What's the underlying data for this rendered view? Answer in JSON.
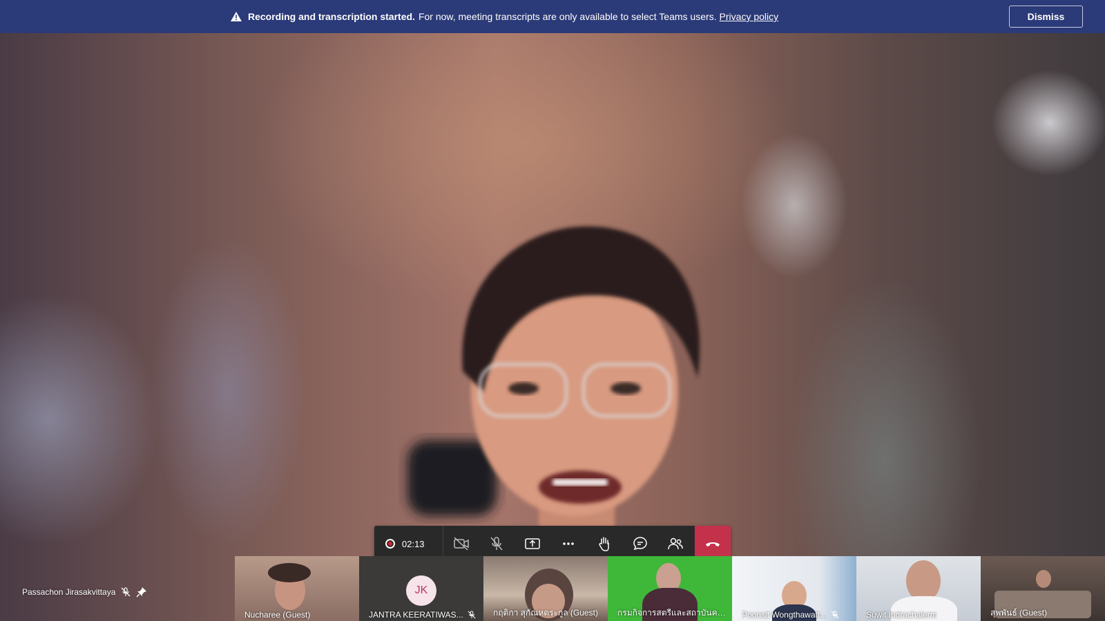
{
  "banner": {
    "bold_text": "Recording and transcription started.",
    "message": "For now, meeting transcripts are only available to select Teams users.",
    "link": "Privacy policy",
    "dismiss_label": "Dismiss",
    "background_color": "#2b3a78"
  },
  "stage": {
    "participant_name": "Passachon Jirasakvittaya",
    "icons": [
      "mic-off-icon",
      "pin-icon"
    ]
  },
  "controls": {
    "recording_time": "02:13",
    "buttons": [
      "camera-off-icon",
      "mic-off-icon",
      "share-screen-icon",
      "more-icon",
      "raise-hand-icon",
      "chat-icon",
      "participants-icon",
      "hang-up-icon"
    ],
    "hangup_color": "#c4314b"
  },
  "gallery": [
    {
      "name": "Nucharee (Guest)",
      "muted": false
    },
    {
      "name": "JANTRA KEERATIWAS...",
      "initials": "JK",
      "muted": true
    },
    {
      "name": "กฤติกา สุกัณหตระกูล (Guest)",
      "muted": false
    },
    {
      "name": "กรมกิจการสตรีและสถาบันคร...",
      "muted": false
    },
    {
      "name": "Poonsit Wongthawatt...",
      "muted": true
    },
    {
      "name": "Suwit Indrachalerm",
      "muted": false
    },
    {
      "name": "สุพพันธ์ (Guest)",
      "muted": false
    }
  ]
}
